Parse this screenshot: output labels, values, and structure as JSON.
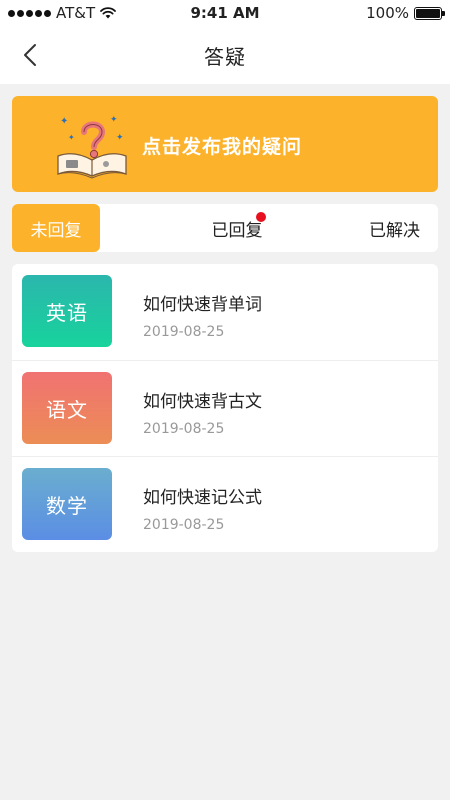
{
  "status_bar": {
    "carrier": "AT&T",
    "time": "9:41 AM",
    "battery": "100%",
    "battery_level": 1.0,
    "icons": [
      "signal-dots-icon",
      "wifi-icon",
      "battery-icon"
    ]
  },
  "nav": {
    "title": "答疑",
    "back_icon": "chevron-left-icon"
  },
  "banner": {
    "text": "点击发布我的疑问",
    "background": "#fdb22b",
    "icon": "question-book-icon"
  },
  "tabs": [
    {
      "label": "未回复",
      "active": true
    },
    {
      "label": "已回复",
      "active": false,
      "has_badge": true
    },
    {
      "label": "已解决",
      "active": false
    }
  ],
  "colors": {
    "accent": "#fdb22b",
    "badge": "#e8101e"
  },
  "questions": [
    {
      "subject": "英语",
      "title": "如何快速背单词",
      "date": "2019-08-25",
      "gradient": [
        "#2bb6ad",
        "#18d39c"
      ]
    },
    {
      "subject": "语文",
      "title": "如何快速背古文",
      "date": "2019-08-25",
      "gradient": [
        "#f07272",
        "#ec8d55"
      ]
    },
    {
      "subject": "数学",
      "title": "如何快速记公式",
      "date": "2019-08-25",
      "gradient": [
        "#6aaecf",
        "#5b8ee4"
      ]
    }
  ]
}
